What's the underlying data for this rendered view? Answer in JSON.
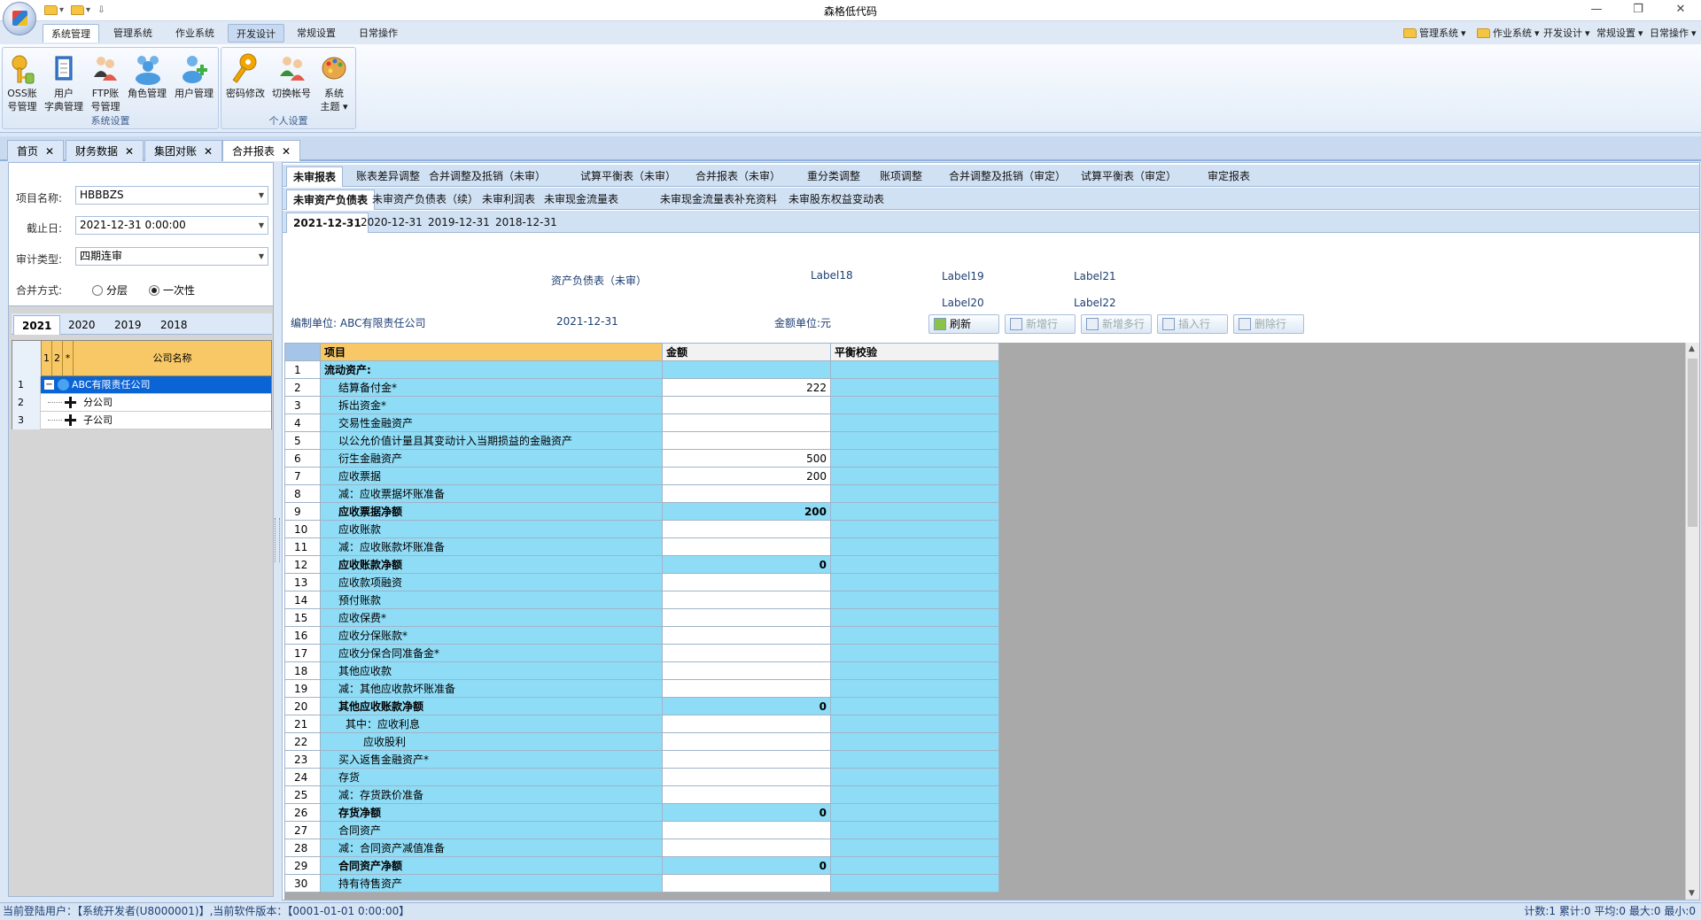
{
  "window": {
    "title": "森格低代码",
    "controls": [
      "—",
      "❐",
      "✕"
    ]
  },
  "ribbon_tabs": [
    "系统管理",
    "管理系统",
    "作业系统",
    "开发设计",
    "常规设置",
    "日常操作"
  ],
  "ribbon_quick": [
    "管理系统",
    "作业系统",
    "开发设计",
    "常规设置",
    "日常操作"
  ],
  "ribbon_groups": {
    "system": {
      "label": "系统设置",
      "buttons": [
        {
          "line1": "OSS账",
          "line2": "号管理"
        },
        {
          "line1": "用户",
          "line2": "字典管理"
        },
        {
          "line1": "FTP账",
          "line2": "号管理"
        },
        {
          "line1": "角色管理",
          "line2": ""
        },
        {
          "line1": "用户管理",
          "line2": ""
        }
      ]
    },
    "personal": {
      "label": "个人设置",
      "buttons": [
        {
          "line1": "密码修改",
          "line2": ""
        },
        {
          "line1": "切换帐号",
          "line2": ""
        },
        {
          "line1": "系统",
          "line2": "主题 ▾"
        }
      ]
    }
  },
  "doc_tabs": [
    "首页",
    "财务数据",
    "集团对账",
    "合并报表"
  ],
  "filter": {
    "project_label": "项目名称:",
    "project_value": "HBBBZS",
    "date_label": "截止日:",
    "date_value": "2021-12-31 0:00:00",
    "audit_label": "审计类型:",
    "audit_value": "四期连审",
    "merge_label": "合并方式:",
    "merge_opt1": "分层",
    "merge_opt2": "一次性"
  },
  "year_tabs": [
    "2021",
    "2020",
    "2019",
    "2018"
  ],
  "tree": {
    "headers": [
      "1",
      "2",
      "*",
      "公司名称"
    ],
    "rows": [
      {
        "no": "1",
        "name": "ABC有限责任公司"
      },
      {
        "no": "2",
        "name": "分公司"
      },
      {
        "no": "3",
        "name": "子公司"
      }
    ]
  },
  "main_tabs_1": [
    "未审报表",
    "账表差异调整",
    "合并调整及抵销（未审）",
    "试算平衡表（未审）",
    "合并报表（未审）",
    "重分类调整",
    "账项调整",
    "合并调整及抵销（审定）",
    "试算平衡表（审定）",
    "审定报表"
  ],
  "main_tabs_2": [
    "未审资产负债表",
    "未审资产负债表（续）",
    "未审利润表",
    "未审现金流量表",
    "未审现金流量表补充资料",
    "未审股东权益变动表"
  ],
  "main_tabs_3": [
    "2021-12-31",
    "2020-12-31",
    "2019-12-31",
    "2018-12-31"
  ],
  "report_header": {
    "title": "资产负债表（未审）",
    "label18": "Label18",
    "label19": "Label19",
    "label20": "Label20",
    "label21": "Label21",
    "label22": "Label22",
    "unit_label": "编制单位:",
    "unit_value": "ABC有限责任公司",
    "date": "2021-12-31",
    "currency_label": "金额单位:",
    "currency_value": "元"
  },
  "toolbar": [
    "刷新",
    "新增行",
    "新增多行",
    "插入行",
    "删除行"
  ],
  "grid": {
    "headers": [
      "项目",
      "金额",
      "平衡校验"
    ],
    "rows": [
      {
        "no": "1",
        "item": "流动资产:",
        "amount": "",
        "bold": true,
        "indent": 0
      },
      {
        "no": "2",
        "item": "结算备付金*",
        "amount": "222",
        "bold": false,
        "indent": 1
      },
      {
        "no": "3",
        "item": "拆出资金*",
        "amount": "",
        "bold": false,
        "indent": 1
      },
      {
        "no": "4",
        "item": "交易性金融资产",
        "amount": "",
        "bold": false,
        "indent": 1
      },
      {
        "no": "5",
        "item": "以公允价值计量且其变动计入当期损益的金融资产",
        "amount": "",
        "bold": false,
        "indent": 1
      },
      {
        "no": "6",
        "item": "衍生金融资产",
        "amount": "500",
        "bold": false,
        "indent": 1
      },
      {
        "no": "7",
        "item": "应收票据",
        "amount": "200",
        "bold": false,
        "indent": 1
      },
      {
        "no": "8",
        "item": "减：应收票据坏账准备",
        "amount": "",
        "bold": false,
        "indent": 1
      },
      {
        "no": "9",
        "item": "应收票据净额",
        "amount": "200",
        "bold": true,
        "indent": 1
      },
      {
        "no": "10",
        "item": "应收账款",
        "amount": "",
        "bold": false,
        "indent": 1
      },
      {
        "no": "11",
        "item": "减：应收账款坏账准备",
        "amount": "",
        "bold": false,
        "indent": 1
      },
      {
        "no": "12",
        "item": "应收账款净额",
        "amount": "0",
        "bold": true,
        "indent": 1
      },
      {
        "no": "13",
        "item": "应收款项融资",
        "amount": "",
        "bold": false,
        "indent": 1
      },
      {
        "no": "14",
        "item": "预付账款",
        "amount": "",
        "bold": false,
        "indent": 1
      },
      {
        "no": "15",
        "item": "应收保费*",
        "amount": "",
        "bold": false,
        "indent": 1
      },
      {
        "no": "16",
        "item": "应收分保账款*",
        "amount": "",
        "bold": false,
        "indent": 1
      },
      {
        "no": "17",
        "item": "应收分保合同准备金*",
        "amount": "",
        "bold": false,
        "indent": 1
      },
      {
        "no": "18",
        "item": "其他应收款",
        "amount": "",
        "bold": false,
        "indent": 1
      },
      {
        "no": "19",
        "item": "减：其他应收款坏账准备",
        "amount": "",
        "bold": false,
        "indent": 1
      },
      {
        "no": "20",
        "item": "其他应收账款净额",
        "amount": "0",
        "bold": true,
        "indent": 1
      },
      {
        "no": "21",
        "item": "其中：应收利息",
        "amount": "",
        "bold": false,
        "indent": 2
      },
      {
        "no": "22",
        "item": "应收股利",
        "amount": "",
        "bold": false,
        "indent": 3
      },
      {
        "no": "23",
        "item": "买入返售金融资产*",
        "amount": "",
        "bold": false,
        "indent": 1
      },
      {
        "no": "24",
        "item": "存货",
        "amount": "",
        "bold": false,
        "indent": 1
      },
      {
        "no": "25",
        "item": "减：存货跌价准备",
        "amount": "",
        "bold": false,
        "indent": 1
      },
      {
        "no": "26",
        "item": "存货净额",
        "amount": "0",
        "bold": true,
        "indent": 1
      },
      {
        "no": "27",
        "item": "合同资产",
        "amount": "",
        "bold": false,
        "indent": 1
      },
      {
        "no": "28",
        "item": "减：合同资产减值准备",
        "amount": "",
        "bold": false,
        "indent": 1
      },
      {
        "no": "29",
        "item": "合同资产净额",
        "amount": "0",
        "bold": true,
        "indent": 1
      },
      {
        "no": "30",
        "item": "持有待售资产",
        "amount": "",
        "bold": false,
        "indent": 1
      }
    ]
  },
  "status": {
    "left": "当前登陆用户：【系统开发者(U8000001)】,当前软件版本：【0001-01-01 0:00:00】",
    "right": "计数:1 累计:0 平均:0 最大:0 最小:0"
  },
  "colors": {
    "grid_item": "#8fdcf6",
    "tree_header": "#f7c865",
    "selection": "#0a64d6"
  }
}
